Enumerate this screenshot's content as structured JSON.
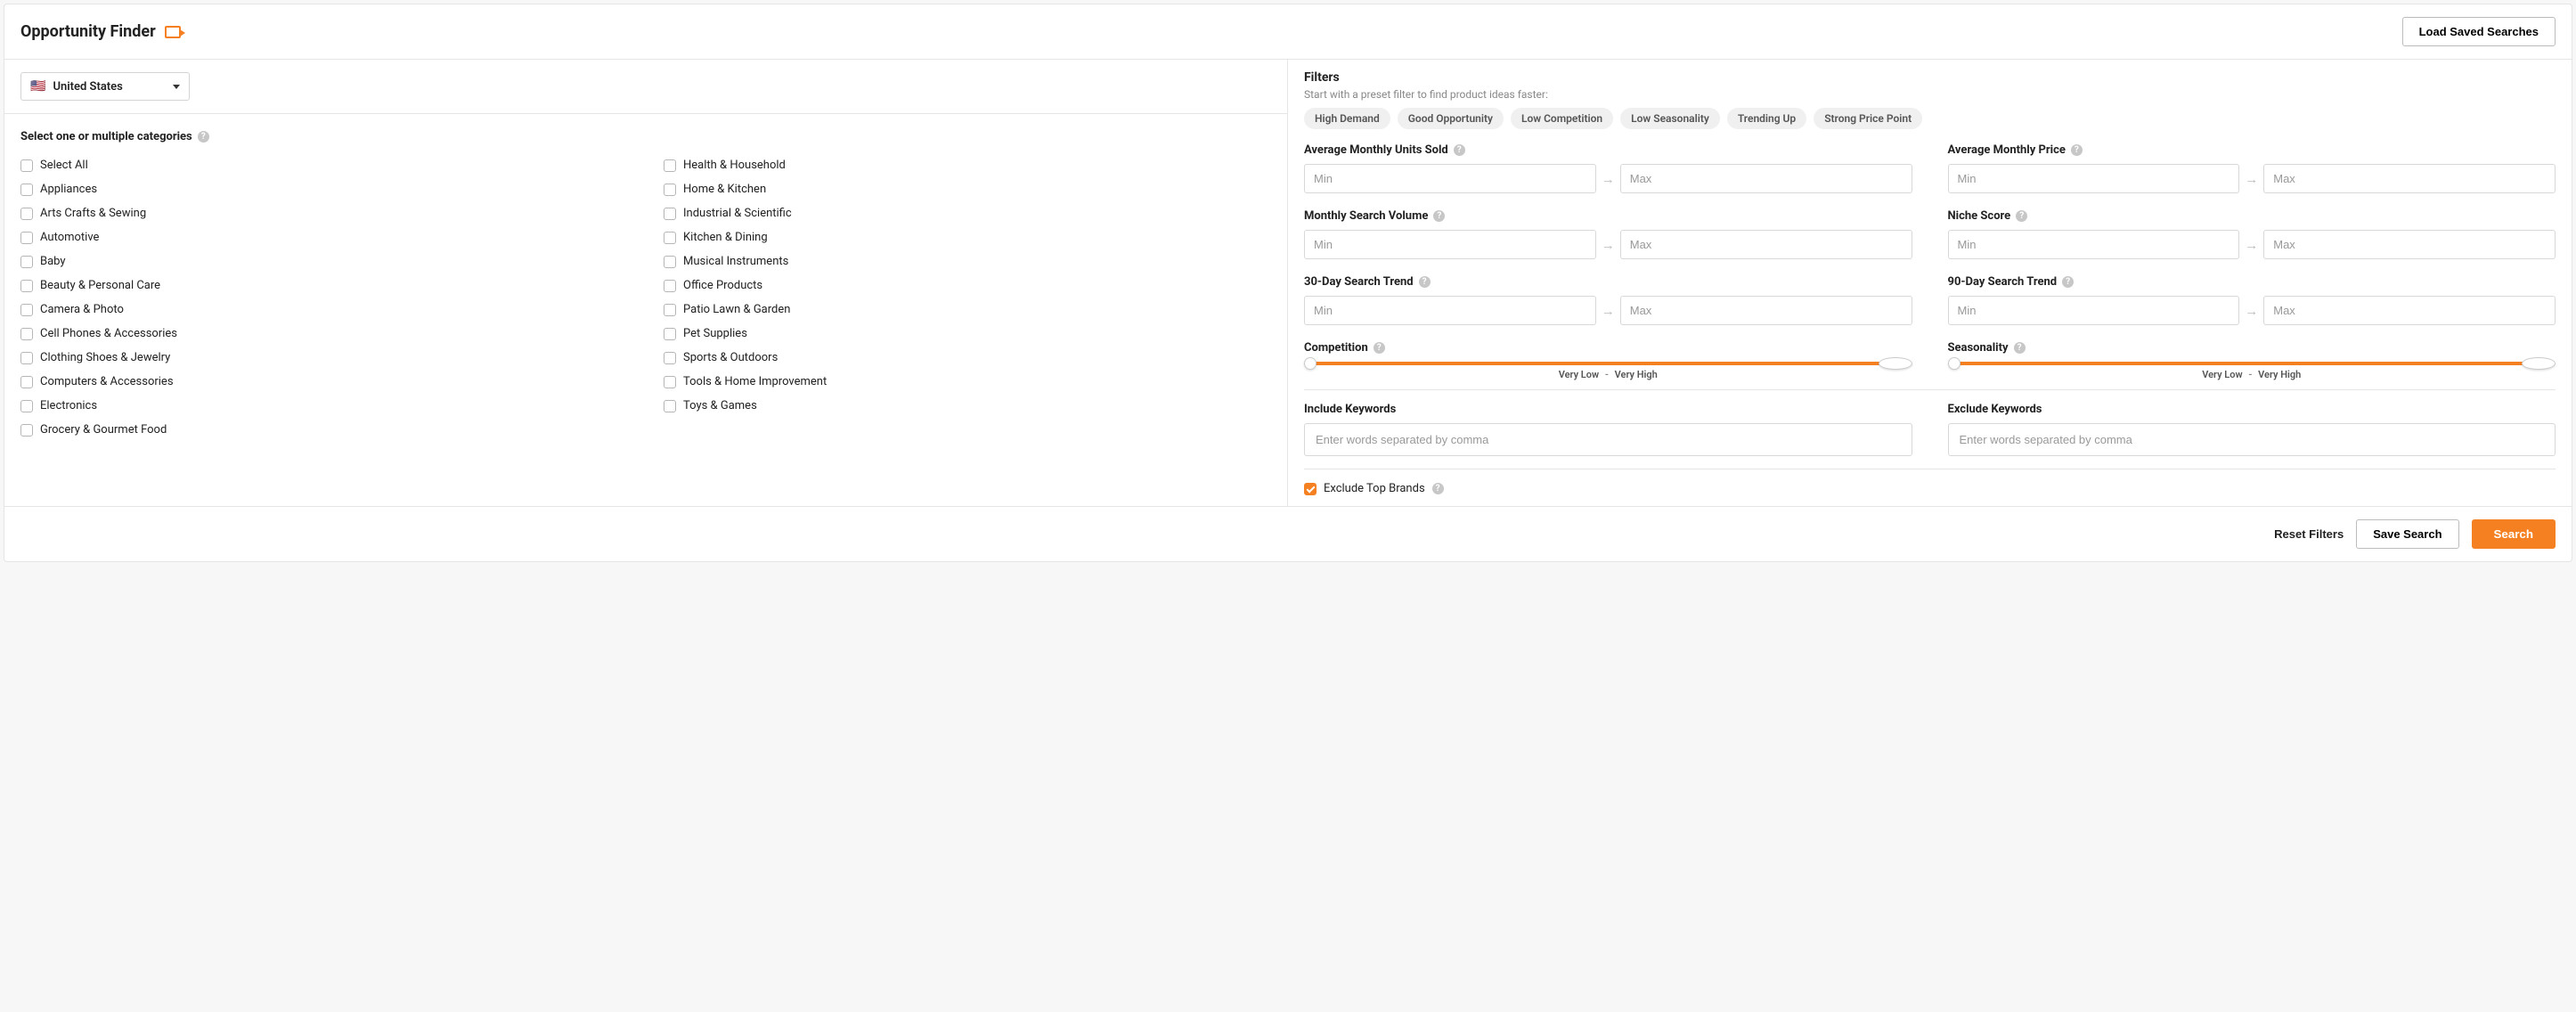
{
  "header": {
    "title": "Opportunity Finder",
    "load_saved": "Load Saved Searches"
  },
  "country": {
    "selected": "United States"
  },
  "categories": {
    "heading": "Select one or multiple categories",
    "col1": [
      "Select All",
      "Appliances",
      "Arts Crafts & Sewing",
      "Automotive",
      "Baby",
      "Beauty & Personal Care",
      "Camera & Photo",
      "Cell Phones & Accessories",
      "Clothing Shoes & Jewelry",
      "Computers & Accessories",
      "Electronics",
      "Grocery & Gourmet Food"
    ],
    "col2": [
      "Health & Household",
      "Home & Kitchen",
      "Industrial & Scientific",
      "Kitchen & Dining",
      "Musical Instruments",
      "Office Products",
      "Patio Lawn & Garden",
      "Pet Supplies",
      "Sports & Outdoors",
      "Tools & Home Improvement",
      "Toys & Games"
    ]
  },
  "filters": {
    "title": "Filters",
    "subtitle": "Start with a preset filter to find product ideas faster:",
    "presets": [
      "High Demand",
      "Good Opportunity",
      "Low Competition",
      "Low Seasonality",
      "Trending Up",
      "Strong Price Point"
    ],
    "fields": {
      "units_sold": "Average Monthly Units Sold",
      "avg_price": "Average Monthly Price",
      "search_vol": "Monthly Search Volume",
      "niche": "Niche Score",
      "trend30": "30-Day Search Trend",
      "trend90": "90-Day Search Trend",
      "competition": "Competition",
      "seasonality": "Seasonality"
    },
    "placeholders": {
      "min": "Min",
      "max": "Max"
    },
    "slider": {
      "low": "Very Low",
      "dash": "-",
      "high": "Very High"
    }
  },
  "keywords": {
    "include_label": "Include Keywords",
    "exclude_label": "Exclude Keywords",
    "placeholder": "Enter words separated by comma"
  },
  "exclude_brands": "Exclude Top Brands",
  "footer": {
    "reset": "Reset Filters",
    "save": "Save Search",
    "search": "Search"
  }
}
